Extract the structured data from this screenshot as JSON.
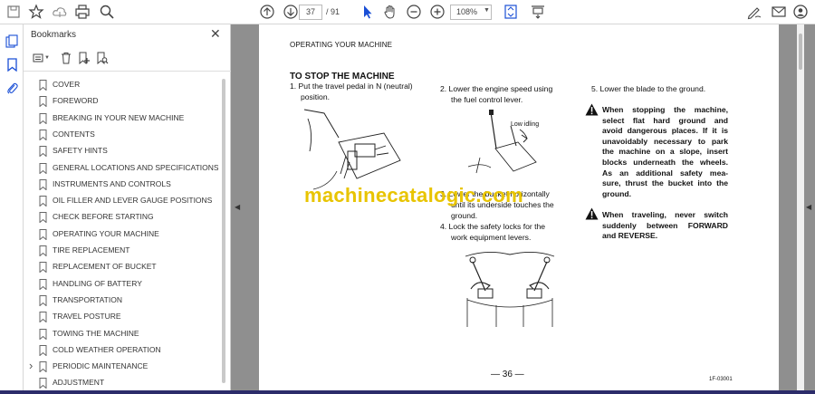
{
  "toolbar": {
    "page_current": "37",
    "page_total": "/ 91",
    "zoom": "108%"
  },
  "bookmarks": {
    "title": "Bookmarks",
    "items": [
      {
        "label": "COVER",
        "expandable": false
      },
      {
        "label": "FOREWORD",
        "expandable": false
      },
      {
        "label": "BREAKING IN YOUR NEW MACHINE",
        "expandable": false
      },
      {
        "label": "CONTENTS",
        "expandable": false
      },
      {
        "label": "SAFETY HINTS",
        "expandable": false
      },
      {
        "label": "GENERAL LOCATIONS AND SPECIFICATIONS",
        "expandable": false
      },
      {
        "label": "INSTRUMENTS AND CONTROLS",
        "expandable": false
      },
      {
        "label": "OIL FILLER AND LEVER GAUGE POSITIONS",
        "expandable": false
      },
      {
        "label": "CHECK BEFORE STARTING",
        "expandable": false
      },
      {
        "label": "OPERATING YOUR MACHINE",
        "expandable": false
      },
      {
        "label": "TIRE REPLACEMENT",
        "expandable": false
      },
      {
        "label": "REPLACEMENT OF BUCKET",
        "expandable": false
      },
      {
        "label": "HANDLING OF BATTERY",
        "expandable": false
      },
      {
        "label": "TRANSPORTATION",
        "expandable": false
      },
      {
        "label": "TRAVEL POSTURE",
        "expandable": false
      },
      {
        "label": "TOWING THE MACHINE",
        "expandable": false
      },
      {
        "label": "COLD WEATHER OPERATION",
        "expandable": false
      },
      {
        "label": "PERIODIC MAINTENANCE",
        "expandable": true
      },
      {
        "label": "ADJUSTMENT",
        "expandable": false
      }
    ]
  },
  "document": {
    "header": "OPERATING YOUR MACHINE",
    "section_title": "TO STOP THE MACHINE",
    "step1_line1": "1.  Put the travel pedal in N (neutral)",
    "step1_line2": "position.",
    "step2_line1": "2.  Lower the engine speed using",
    "step2_line2": "the fuel control lever.",
    "low_idling": "Low idling",
    "step3_line1": "3.  Lower the bucket horizontally",
    "step3_line2": "until its underside touches the",
    "step3_line3": "ground.",
    "step4_line1": "4.  Lock the safety locks for the",
    "step4_line2": "work equipment levers.",
    "step5": "5.  Lower the blade to the ground.",
    "warning1": [
      "When stopping the machine,",
      "select flat hard ground and",
      "avoid dangerous places. If it is",
      "unavoidably necessary to park",
      "the machine on a slope, insert",
      "blocks underneath the wheels.",
      "As an additional safety mea-",
      "sure, thrust the bucket into the",
      "ground."
    ],
    "warning2": [
      "When traveling, never switch",
      "suddenly between FORWARD",
      "and REVERSE."
    ],
    "page_number": "— 36 —",
    "fig_code": "1F-03001",
    "watermark": "machinecatalogic.com"
  },
  "colors": {
    "accent_blue": "#1a4fd6",
    "watermark": "#e8c400",
    "doc_background": "#8f8f8f"
  }
}
